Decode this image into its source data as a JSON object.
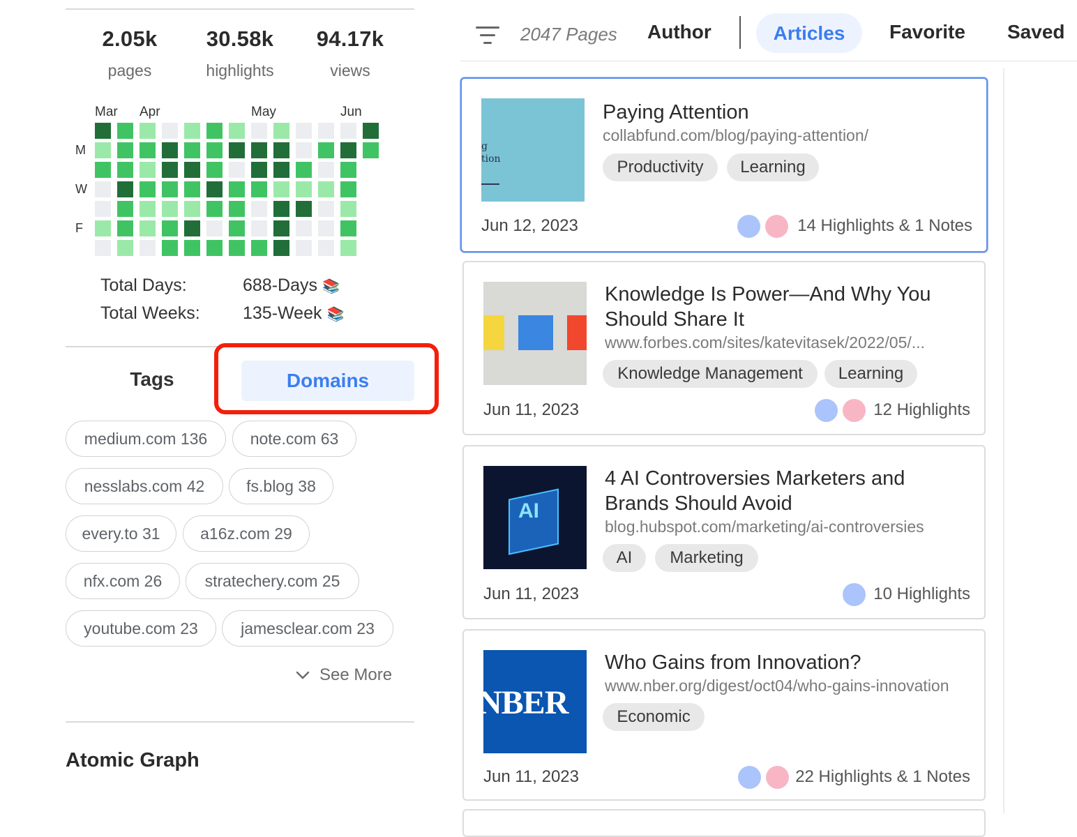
{
  "stats": [
    {
      "value": "2.05k",
      "label": "pages"
    },
    {
      "value": "30.58k",
      "label": "highlights"
    },
    {
      "value": "94.17k",
      "label": "views"
    }
  ],
  "heatmap": {
    "months": [
      "Mar",
      "Apr",
      "May",
      "Jun"
    ],
    "days": [
      "M",
      "W",
      "F"
    ],
    "columns": [
      [
        4,
        1,
        2,
        0,
        0,
        1,
        0
      ],
      [
        2,
        2,
        2,
        4,
        2,
        2,
        1
      ],
      [
        1,
        2,
        1,
        2,
        1,
        1,
        0
      ],
      [
        0,
        4,
        4,
        2,
        1,
        2,
        2
      ],
      [
        1,
        2,
        4,
        2,
        1,
        4,
        2
      ],
      [
        2,
        2,
        2,
        4,
        2,
        0,
        2
      ],
      [
        1,
        4,
        0,
        2,
        2,
        2,
        2
      ],
      [
        0,
        4,
        4,
        2,
        0,
        0,
        2
      ],
      [
        1,
        4,
        4,
        1,
        4,
        4,
        4
      ],
      [
        0,
        0,
        2,
        1,
        4,
        0,
        0
      ],
      [
        0,
        2,
        0,
        1,
        0,
        0,
        0
      ],
      [
        0,
        4,
        2,
        2,
        1,
        2,
        1
      ],
      [
        4,
        2,
        -1,
        -1,
        -1,
        -1,
        -1
      ]
    ]
  },
  "totals": {
    "days_label": "Total Days:",
    "days_value": "688-Days",
    "weeks_label": "Total Weeks:",
    "weeks_value": "135-Week"
  },
  "tabs": {
    "tags": "Tags",
    "domains": "Domains"
  },
  "domains": [
    {
      "label": "medium.com 136"
    },
    {
      "label": "note.com 63"
    },
    {
      "label": "nesslabs.com 42"
    },
    {
      "label": "fs.blog 38"
    },
    {
      "label": "every.to 31"
    },
    {
      "label": "a16z.com 29"
    },
    {
      "label": "nfx.com 26"
    },
    {
      "label": "stratechery.com 25"
    },
    {
      "label": "youtube.com 23"
    },
    {
      "label": "jamesclear.com 23"
    }
  ],
  "see_more": "See More",
  "atomic_graph": "Atomic Graph",
  "toolbar": {
    "pages_count": "2047 Pages",
    "nav": [
      "Author",
      "Articles",
      "Favorite",
      "Saved"
    ],
    "active_nav": "Articles"
  },
  "articles": [
    {
      "title": "Paying Attention",
      "url": "collabfund.com/blog/paying-attention/",
      "tags": [
        "Productivity",
        "Learning"
      ],
      "date": "Jun 12, 2023",
      "count": "14 Highlights & 1 Notes",
      "thumb_text": "g\ntion"
    },
    {
      "title": "Knowledge Is Power—And Why You Should Share It",
      "url": "www.forbes.com/sites/katevitasek/2022/05/...",
      "tags": [
        "Knowledge Management",
        "Learning"
      ],
      "date": "Jun 11, 2023",
      "count": "12 Highlights"
    },
    {
      "title": "4 AI Controversies Marketers and Brands Should Avoid",
      "url": "blog.hubspot.com/marketing/ai-controversies",
      "tags": [
        "AI",
        "Marketing"
      ],
      "date": "Jun 11, 2023",
      "count": "10 Highlights",
      "thumb_text": "AI"
    },
    {
      "title": "Who Gains from Innovation?",
      "url": "www.nber.org/digest/oct04/who-gains-innovation",
      "tags": [
        "Economic"
      ],
      "date": "Jun 11, 2023",
      "count": "22 Highlights & 1 Notes",
      "thumb_text": "NBER"
    }
  ],
  "colors": {
    "accent": "#3b7ef0",
    "accent_bg": "#edf3fe",
    "highlight_border": "#f41f0b",
    "heat_levels": [
      "#ebedf0",
      "#9be9a8",
      "#40c463",
      "#30a14e",
      "#216e39"
    ]
  }
}
